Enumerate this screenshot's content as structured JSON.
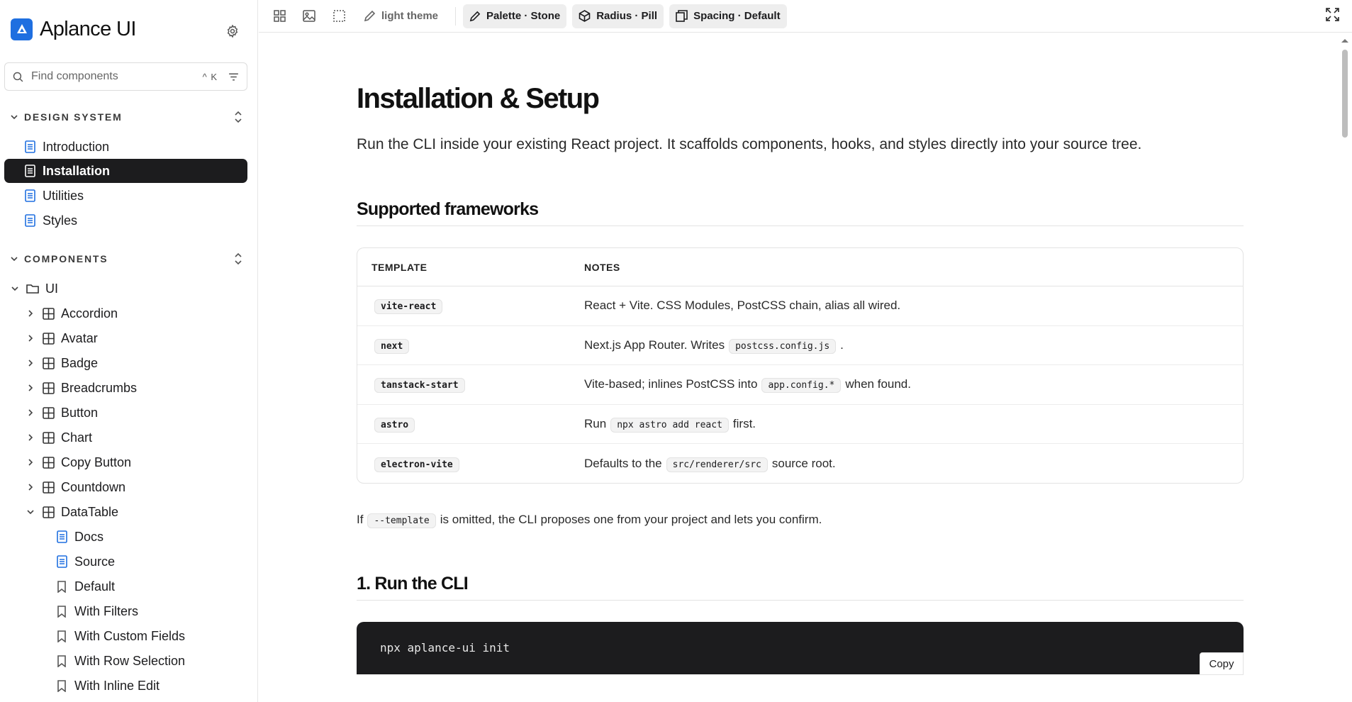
{
  "brand": {
    "name": "Aplance UI"
  },
  "search": {
    "placeholder": "Find components",
    "shortcut": "^ K"
  },
  "sidebar": {
    "design_system": {
      "label": "DESIGN SYSTEM",
      "items": [
        {
          "label": "Introduction",
          "active": false
        },
        {
          "label": "Installation",
          "active": true
        },
        {
          "label": "Utilities",
          "active": false
        },
        {
          "label": "Styles",
          "active": false
        }
      ]
    },
    "components": {
      "label": "COMPONENTS",
      "folder": "UI",
      "groups": [
        "Accordion",
        "Avatar",
        "Badge",
        "Breadcrumbs",
        "Button",
        "Chart",
        "Copy Button",
        "Countdown",
        "DataTable"
      ],
      "datatable_children": {
        "docs": [
          "Docs",
          "Source"
        ],
        "stories": [
          "Default",
          "With Filters",
          "With Custom Fields",
          "With Row Selection",
          "With Inline Edit"
        ]
      }
    }
  },
  "toolbar": {
    "theme_label": "light theme",
    "chips": [
      "Palette · Stone",
      "Radius · Pill",
      "Spacing · Default"
    ]
  },
  "page": {
    "title": "Installation & Setup",
    "lead": "Run the CLI inside your existing React project. It scaffolds components, hooks, and styles directly into your source tree.",
    "frameworks_heading": "Supported frameworks",
    "table": {
      "headers": [
        "TEMPLATE",
        "NOTES"
      ],
      "rows": [
        {
          "template": "vite-react",
          "pre": "React + Vite. CSS Modules, PostCSS chain, alias all wired.",
          "code": "",
          "post": ""
        },
        {
          "template": "next",
          "pre": "Next.js App Router. Writes",
          "code": "postcss.config.js",
          "post": "."
        },
        {
          "template": "tanstack-start",
          "pre": "Vite-based; inlines PostCSS into",
          "code": "app.config.*",
          "post": "when found."
        },
        {
          "template": "astro",
          "pre": "Run",
          "code": "npx astro add react",
          "post": "first."
        },
        {
          "template": "electron-vite",
          "pre": "Defaults to the",
          "code": "src/renderer/src",
          "post": "source root."
        }
      ]
    },
    "note": {
      "pre": "If",
      "code": "--template",
      "post": "is omitted, the CLI proposes one from your project and lets you confirm."
    },
    "step1_heading": "1. Run the CLI",
    "step1_command": "npx aplance-ui init",
    "copy_label": "Copy"
  },
  "colors": {
    "brand": "#1f6fe0",
    "active_bg": "#1c1c1e",
    "doc_icon": "#1f6fe0"
  }
}
